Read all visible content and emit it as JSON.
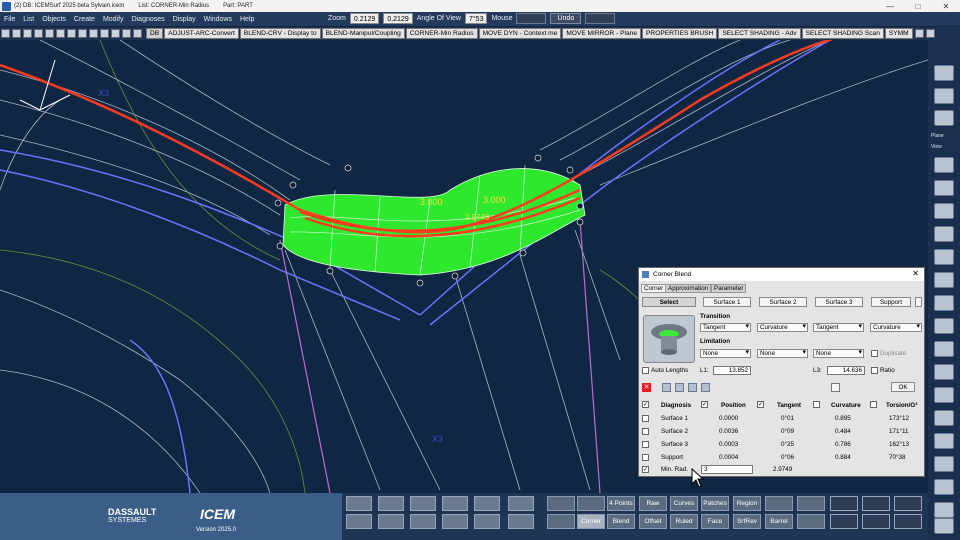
{
  "window": {
    "title": "(2) DB: ICEMSurf 2025 beta Sylvain.icem",
    "list": "List: CORNER-Min Radius",
    "part": "Part: PART",
    "controls": [
      "—",
      "□",
      "✕"
    ]
  },
  "menu": [
    "File",
    "List",
    "Objects",
    "Create",
    "Modify",
    "Diagnoses",
    "Display",
    "Windows",
    "Help"
  ],
  "zoombar": {
    "zoom_label": "Zoom",
    "zoom_value": "0.2129",
    "zoom_value2": "0.2129",
    "aov_label": "Angle Of View",
    "aov_value": "7°53",
    "mouse_label": "Mouse",
    "undo_label": "Undo"
  },
  "shortcuts": [
    "DB",
    "ADJUST-ARC-Convert",
    "BLEND-CRV - Display to",
    "BLEND-Manipul/Coupling",
    "CORNER-Min Radius",
    "MOVE DYN - Context me",
    "MOVE MIRROR - Plane",
    "PROPERTIES BRUSH",
    "SELECT SHADING - Adv",
    "SELECT SHADING Scan",
    "SYMM"
  ],
  "viewport_labels": {
    "radius1": "3.000",
    "radius2": "3.000",
    "radius_mid": "2.9749",
    "tag_a": "X3",
    "tag_b": "X3"
  },
  "right_toolbar": {
    "plane_label": "Plane",
    "view_label": "View"
  },
  "brand": {
    "company_line1": "DASSAULT",
    "company_line2": "SYSTEMES",
    "product": "ICEM",
    "version": "Version 2025.0"
  },
  "bottom_buttons": {
    "row1": [
      "4 Points",
      "Raw",
      "Curves",
      "Patches",
      "Region"
    ],
    "row2": [
      "Corner",
      "Blend",
      "Offset",
      "Ruled",
      "Face",
      "SrfRev",
      "Barrel"
    ],
    "selected": "Corner"
  },
  "dialog": {
    "title": "Corner Blend",
    "tabs": [
      "Corner",
      "Approximation",
      "Parameter"
    ],
    "select_label": "Select",
    "surfaces": [
      "Surface 1",
      "Surface 2",
      "Surface 3",
      "Support"
    ],
    "transition_label": "Transition",
    "transition": [
      "Tangent",
      "Curvature",
      "Tangent",
      "Curvature"
    ],
    "limitation_label": "Limitation",
    "limitation": [
      "None",
      "None",
      "None"
    ],
    "duplicate_label": "Duplicate",
    "auto_lengths_label": "Auto Lengths",
    "l1_label": "L1:",
    "l1_value": "13.852",
    "l3_label": "L3:",
    "l3_value": "14.636",
    "ratio_label": "Ratio",
    "ok_label": "OK",
    "diag_headers": [
      "Diagnosis",
      "Position",
      "Tangent",
      "Curvature",
      "Torsion/G³"
    ],
    "diag_rows": [
      {
        "name": "Surface 1",
        "position": "0.0000",
        "tangent": "0°01",
        "curvature": "0.895",
        "torsion": "173°12"
      },
      {
        "name": "Surface 2",
        "position": "0.0036",
        "tangent": "0°09",
        "curvature": "0.484",
        "torsion": "171°11"
      },
      {
        "name": "Surface 3",
        "position": "0.0003",
        "tangent": "0°25",
        "curvature": "0.786",
        "torsion": "162°13"
      },
      {
        "name": "Support",
        "position": "0.0004",
        "tangent": "0°06",
        "curvature": "0.884",
        "torsion": "70°38"
      }
    ],
    "min_rad_label": "Min. Rad.",
    "min_rad_input": "3",
    "min_rad_value": "2.9749"
  },
  "colors": {
    "viewport": "#0f2743",
    "blend": "#2ee82e",
    "highlight": "#ff3b1f",
    "wire": "#c9cfe0",
    "curve": "#6b73ff"
  }
}
